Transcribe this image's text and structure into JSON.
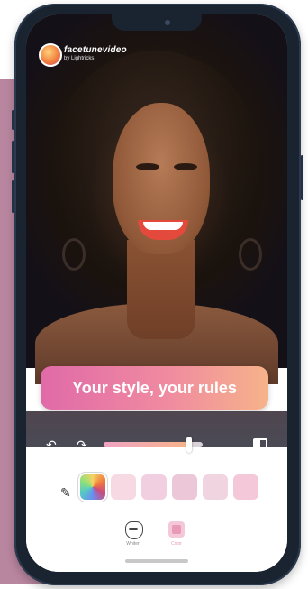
{
  "app": {
    "name": "facetunevideo",
    "subtitle": "by Lightricks"
  },
  "banner": {
    "text": "Your style, your rules"
  },
  "controls": {
    "undo_icon": "undo-icon",
    "redo_icon": "redo-icon",
    "compare_icon": "compare-icon",
    "intensity": 0.86
  },
  "palette": {
    "tool_icon": "pen-icon",
    "swatches": [
      {
        "name": "gradient",
        "color": "multi"
      },
      {
        "name": "pink-1",
        "color": "#f7d9e3"
      },
      {
        "name": "pink-2",
        "color": "#f2cfe0"
      },
      {
        "name": "pink-3",
        "color": "#ecc7d8"
      },
      {
        "name": "pink-4",
        "color": "#f0d5e1"
      },
      {
        "name": "pink-5",
        "color": "#f4c8d8"
      }
    ]
  },
  "tabs": [
    {
      "label": "Whiten",
      "icon": "mouth-icon"
    },
    {
      "label": "Color",
      "icon": "color-icon"
    }
  ],
  "colors": {
    "accent": "#e06aa8",
    "accent2": "#f6b38a",
    "frame": "#1a2330",
    "side_panel": "#b9869f"
  }
}
